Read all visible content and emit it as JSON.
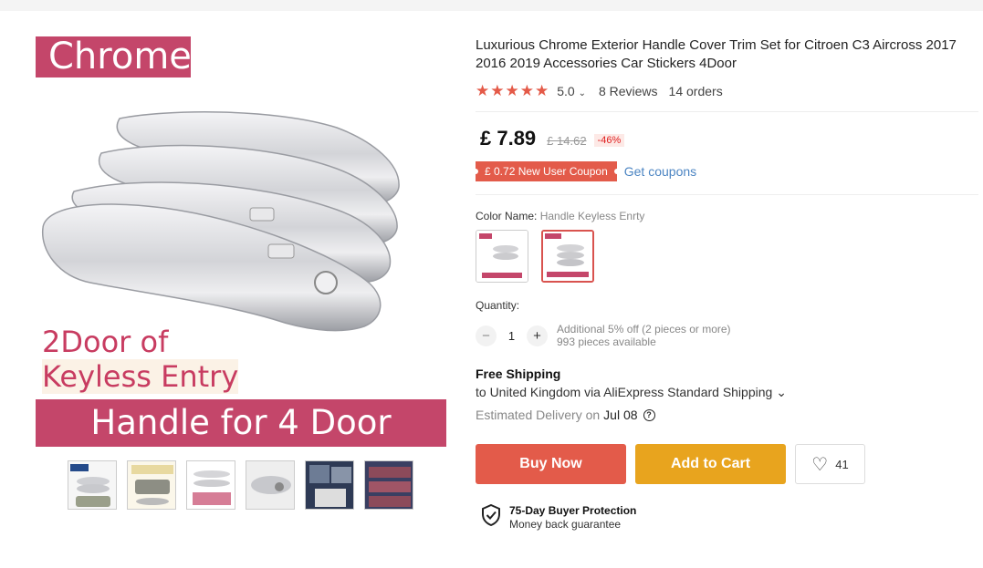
{
  "hero": {
    "chrome_label": "Chrome",
    "keyless_line1": "2Door of",
    "keyless_line2": "Keyless Entry",
    "handle_label": "Handle for 4 Door"
  },
  "product": {
    "title": "Luxurious Chrome Exterior Handle Cover Trim Set for Citroen C3 Aircross 2017 2016 2019 Accessories Car Stickers 4Door",
    "stars": "★★★★★",
    "rating": "5.0",
    "rating_chevron": "⌄",
    "reviews": "8 Reviews",
    "orders": "14 orders",
    "price": "£ 7.89",
    "old_price": "£ 14.62",
    "discount": "-46%",
    "coupon": "£ 0.72 New User Coupon",
    "get_coupons": "Get coupons",
    "color_label": "Color Name: ",
    "color_value": "Handle Keyless Enrty",
    "quantity_label": "Quantity:",
    "quantity_value": "1",
    "minus": "−",
    "plus": "+",
    "qty_note1": "Additional 5% off (2 pieces or more)",
    "qty_note2": "993 pieces available",
    "shipping_title": "Free Shipping",
    "shipping_line": "to United Kingdom via AliExpress Standard Shipping ⌄",
    "eta_label": "Estimated Delivery on",
    "eta_date": "Jul 08",
    "eta_help": "?",
    "buy_now": "Buy Now",
    "add_to_cart": "Add to Cart",
    "wishlist_count": "41",
    "heart": "♡",
    "protection_title": "75-Day Buyer Protection",
    "protection_sub": "Money back guarantee"
  },
  "colors": {
    "accent_red": "#e35b4a",
    "accent_orange": "#e8a41e",
    "banner_pink": "#c4466a"
  }
}
